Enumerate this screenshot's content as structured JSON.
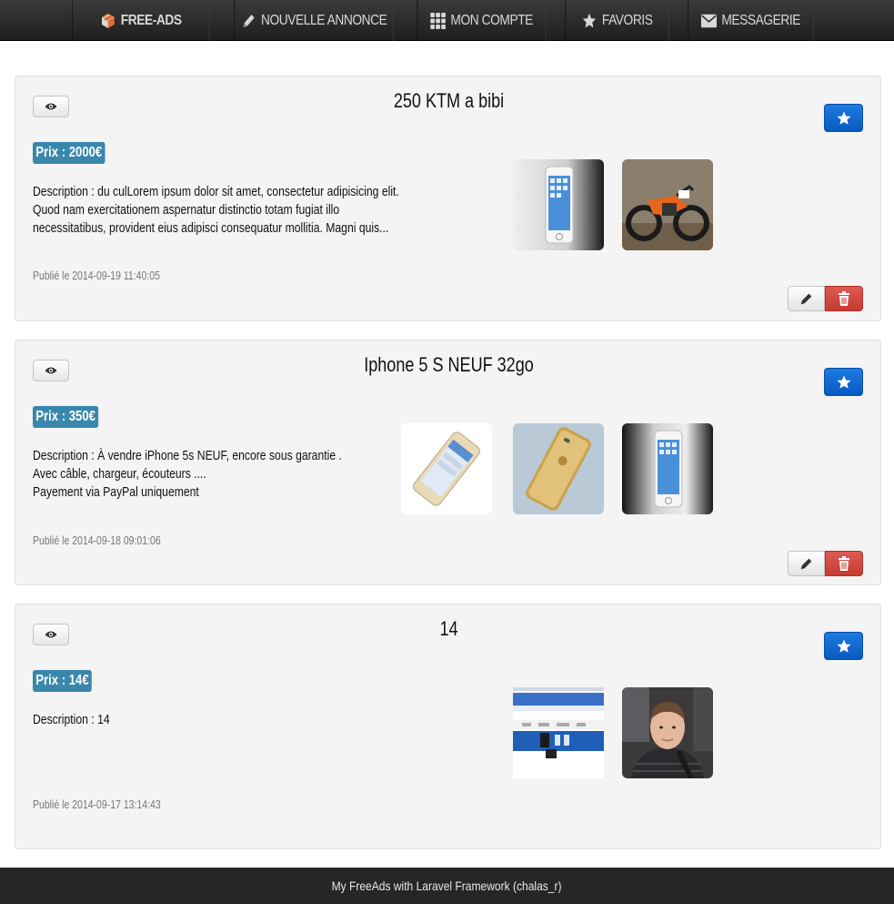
{
  "nav": {
    "items": [
      {
        "label": "FREE-ADS",
        "icon": "cube-icon"
      },
      {
        "label": "NOUVELLE ANNONCE",
        "icon": "pencil-icon"
      },
      {
        "label": "MON COMPTE",
        "icon": "grid-icon"
      },
      {
        "label": "FAVORIS",
        "icon": "star-icon"
      },
      {
        "label": "MESSAGERIE",
        "icon": "envelope-icon"
      }
    ]
  },
  "ads": [
    {
      "title": "250 KTM a bibi",
      "price": "Prix : 2000€",
      "description": "Description : du culLorem ipsum dolor sit amet, consectetur adipisicing elit. Quod nam exercitationem aspernatur distinctio totam fugiat illo necessitatibus, provident eius adipisci consequatur mollitia. Magni quis...",
      "date": "Publié le 2014-09-19 11:40:05",
      "images": [
        "iphone-photo",
        "motocross-photo"
      ]
    },
    {
      "title": "Iphone 5 S NEUF 32go",
      "price": "Prix : 350€",
      "description_lines": [
        "Description : À vendre iPhone 5s NEUF, encore sous garantie .",
        "Avec câble, chargeur, écouteurs ....",
        "Payement via PayPal uniquement"
      ],
      "date": "Publié le 2014-09-18 09:01:06",
      "images": [
        "iphone-gold-photo",
        "iphone-back-photo",
        "iphone-photo"
      ]
    },
    {
      "title": "14",
      "price": "Prix : 14€",
      "description": "Description : 14",
      "date": "Publié le 2014-09-17 13:14:43",
      "images": [
        "website-screenshot-photo",
        "portrait-photo"
      ]
    }
  ],
  "footer": {
    "text": "My FreeAds with Laravel Framework (chalas_r)"
  },
  "colors": {
    "price_badge": "#3a87ad",
    "favorite_button": "#0d66d0",
    "delete_button": "#d2453f",
    "navbar": "#2b2b2b",
    "card": "#f4f4f4"
  }
}
